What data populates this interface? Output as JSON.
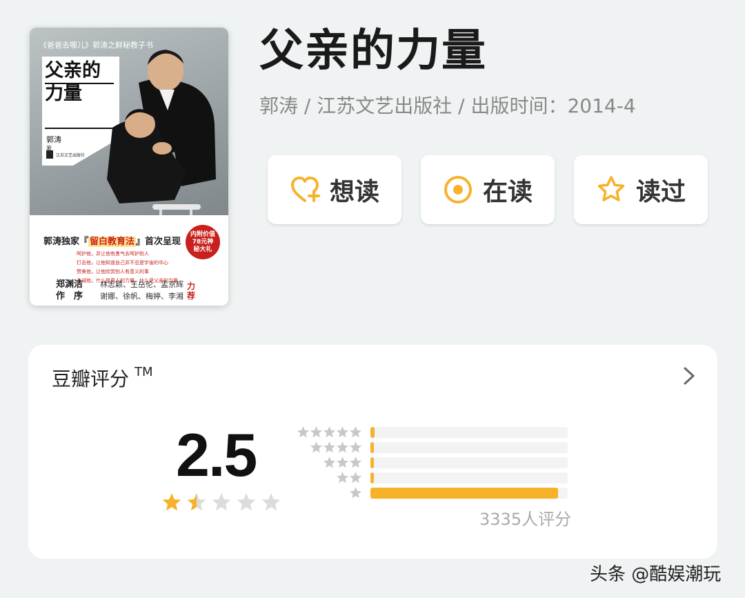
{
  "book": {
    "title": "父亲的力量",
    "meta": "郭涛 / 江苏文艺出版社 / 出版时间：2014-4"
  },
  "cover": {
    "series": "《爸爸去哪儿》郭涛之鲜秘教子书",
    "title": "父亲的力量",
    "author": "郭涛",
    "author_suffix": "著",
    "publisher": "江苏文艺出版社",
    "slogan_prefix": "郭涛独家『",
    "slogan_highlight": "留白教育法",
    "slogan_suffix": "』首次呈现",
    "badge": "内附价值78元神秘大礼",
    "lines": [
      "呵护他，并让他有勇气去呵护别人",
      "打击他，让他知道自己并不总是宇宙的中心",
      "赞美他，让他欣赏别人有意义的事",
      "善诫他，什么是男人的力量，什么是父亲的力量"
    ],
    "foreword_names": "郑渊洁",
    "foreword_label": "作　序",
    "recommenders_1": "林志颖、王岳伦、孟京辉",
    "recommenders_2": "谢娜、徐帆、梅婷、李湘",
    "recommend_label": "力荐"
  },
  "actions": [
    {
      "label": "想读",
      "icon": "heart-plus-icon"
    },
    {
      "label": "在读",
      "icon": "target-circle-icon"
    },
    {
      "label": "读过",
      "icon": "star-outline-icon"
    }
  ],
  "rating": {
    "heading": "豆瓣评分",
    "trademark": "TM",
    "score": "2.5",
    "stars": 1.5,
    "distribution": [
      {
        "stars": 5,
        "fraction": 0.02
      },
      {
        "stars": 4,
        "fraction": 0.01
      },
      {
        "stars": 3,
        "fraction": 0.01
      },
      {
        "stars": 2,
        "fraction": 0.01
      },
      {
        "stars": 1,
        "fraction": 0.95
      }
    ],
    "count": "3335人评分"
  },
  "colors": {
    "accent": "#f7b22c",
    "star_gold": "#f7b22c",
    "star_empty": "#dcdcdc",
    "background": "#f0f3f3"
  },
  "watermark": "头条 @酷娱潮玩"
}
